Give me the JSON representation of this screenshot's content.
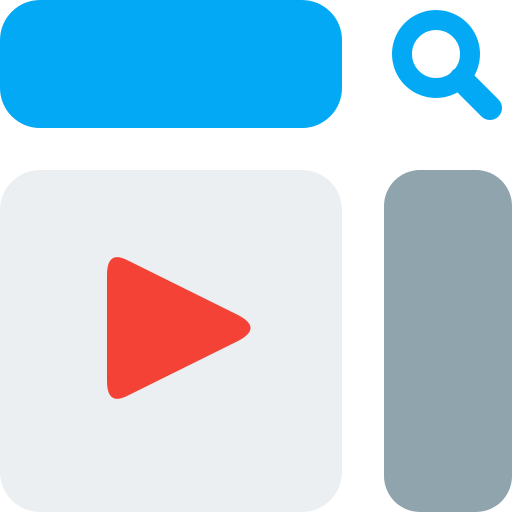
{
  "icons": {
    "search": "search-icon",
    "play": "play-icon"
  },
  "colors": {
    "accent": "#03a9f4",
    "panel": "#eceff1",
    "sidebar": "#90a4ae",
    "play": "#f44336"
  }
}
